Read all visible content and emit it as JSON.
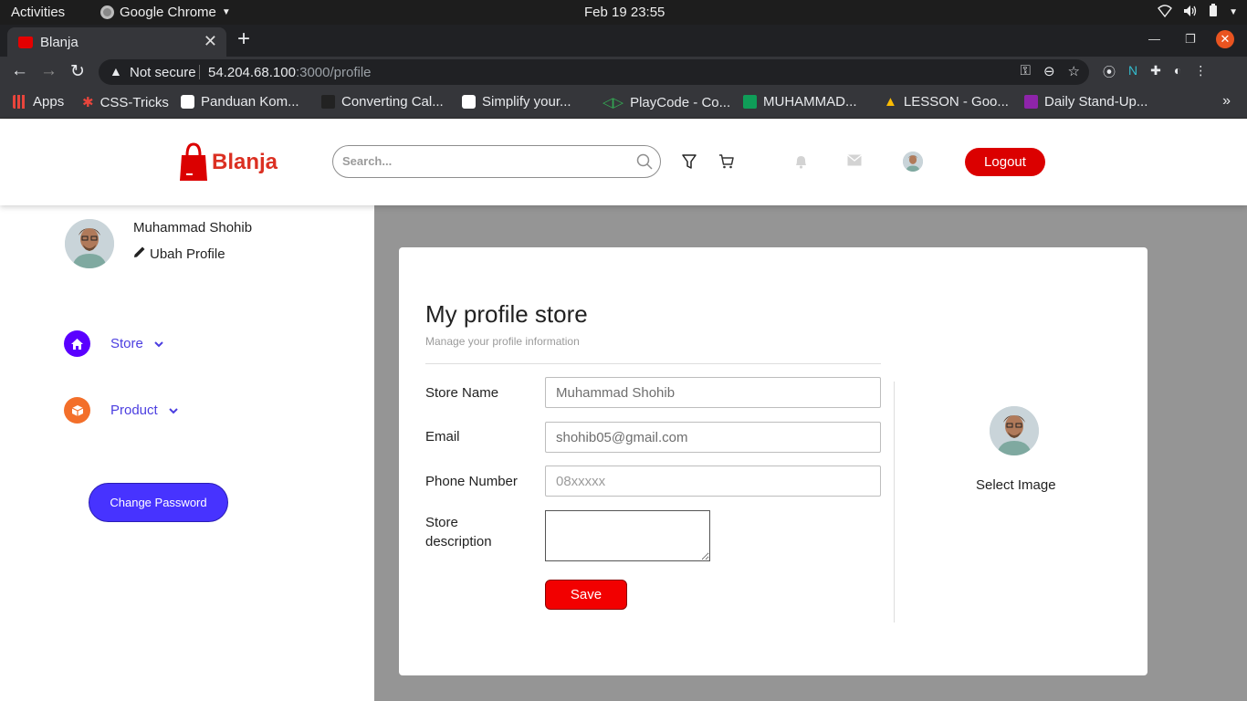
{
  "os": {
    "activities": "Activities",
    "app_name": "Google Chrome",
    "clock": "Feb 19  23:55"
  },
  "browser": {
    "tab_title": "Blanja",
    "omnibox": {
      "security": "Not secure",
      "host": "54.204.68.100",
      "path": ":3000/profile"
    },
    "bookmarks": [
      {
        "label": "Apps",
        "color": "#e8453c"
      },
      {
        "label": "CSS-Tricks",
        "color": "#e8453c"
      },
      {
        "label": "Panduan Kom...",
        "color": "#ffffff"
      },
      {
        "label": "Converting Cal...",
        "color": "#333333"
      },
      {
        "label": "Simplify your...",
        "color": "#ffffff"
      },
      {
        "label": "PlayCode - Co...",
        "color": "#34a853"
      },
      {
        "label": "MUHAMMAD...",
        "color": "#0f9d58"
      },
      {
        "label": "LESSON - Goo...",
        "color": "#fbbc04"
      },
      {
        "label": "Daily Stand-Up...",
        "color": "#8e24aa"
      }
    ]
  },
  "header": {
    "brand": "Blanja",
    "brand_color": "#db3022",
    "search_placeholder": "Search...",
    "logout_label": "Logout"
  },
  "sidebar": {
    "user_name": "Muhammad Shohib",
    "edit_label": "Ubah Profile",
    "items": [
      {
        "label": "Store",
        "icon": "home-icon",
        "color": "#5a00ff"
      },
      {
        "label": "Product",
        "icon": "box-icon",
        "color": "#f36f2a"
      }
    ],
    "change_password_label": "Change Password"
  },
  "main": {
    "title": "My profile store",
    "subtitle": "Manage your profile information",
    "fields": {
      "store_name": {
        "label": "Store Name",
        "value": "Muhammad Shohib"
      },
      "email": {
        "label": "Email",
        "value": "shohib05@gmail.com"
      },
      "phone": {
        "label": "Phone Number",
        "placeholder": "08xxxxx"
      },
      "description": {
        "label_line1": "Store",
        "label_line2": "description",
        "value": ""
      }
    },
    "save_label": "Save",
    "select_image_label": "Select Image"
  }
}
